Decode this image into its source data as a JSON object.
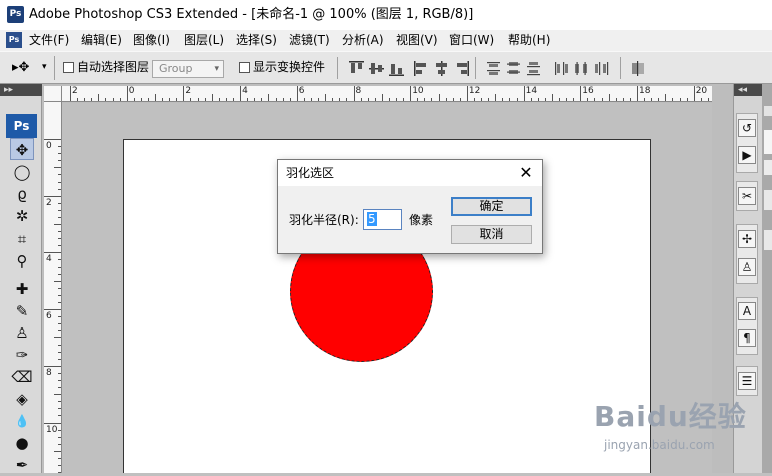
{
  "window": {
    "title": "Adobe Photoshop CS3 Extended - [未命名-1 @ 100% (图层 1, RGB/8)]",
    "app_icon": "Ps",
    "accent": "#1e5aa8"
  },
  "menu": {
    "icon": "Ps",
    "items": [
      "文件(F)",
      "编辑(E)",
      "图像(I)",
      "图层(L)",
      "选择(S)",
      "滤镜(T)",
      "分析(A)",
      "视图(V)",
      "窗口(W)",
      "帮助(H)"
    ]
  },
  "options": {
    "tool_glyph": "▸✥",
    "auto_select_label": "自动选择图层",
    "group_value": "Group",
    "show_transform_label": "显示变换控件"
  },
  "toolbox": {
    "logo": "Ps",
    "tools": [
      {
        "name": "move-tool-icon",
        "glyph": "✥"
      },
      {
        "name": "marquee-tool-icon",
        "glyph": "◯"
      },
      {
        "name": "lasso-tool-icon",
        "glyph": "ϱ"
      },
      {
        "name": "magic-wand-tool-icon",
        "glyph": "✲"
      },
      {
        "name": "crop-tool-icon",
        "glyph": "⌗"
      },
      {
        "name": "eyedropper-tool-icon",
        "glyph": "⚲"
      },
      {
        "name": "healing-brush-tool-icon",
        "glyph": "✚"
      },
      {
        "name": "brush-tool-icon",
        "glyph": "✎"
      },
      {
        "name": "stamp-tool-icon",
        "glyph": "♙"
      },
      {
        "name": "history-brush-tool-icon",
        "glyph": "✑"
      },
      {
        "name": "eraser-tool-icon",
        "glyph": "⌫"
      },
      {
        "name": "paint-bucket-tool-icon",
        "glyph": "◈"
      },
      {
        "name": "blur-tool-icon",
        "glyph": "💧"
      },
      {
        "name": "dodge-tool-icon",
        "glyph": "●"
      },
      {
        "name": "pen-tool-icon",
        "glyph": "✒"
      }
    ]
  },
  "rulers": {
    "h_labels": [
      "2",
      "0",
      "2",
      "4",
      "6",
      "8",
      "10",
      "12",
      "14",
      "16",
      "18",
      "20"
    ],
    "v_labels": [
      "0",
      "2",
      "4",
      "6",
      "8",
      "10"
    ]
  },
  "dock": {
    "buttons": [
      {
        "name": "history-panel-icon",
        "glyph": "↺"
      },
      {
        "name": "actions-panel-icon",
        "glyph": "▶"
      },
      {
        "name": "tool-presets-icon",
        "glyph": "✂"
      },
      {
        "name": "brushes-panel-icon",
        "glyph": "✢"
      },
      {
        "name": "clone-source-icon",
        "glyph": "♙"
      },
      {
        "name": "character-panel-icon",
        "glyph": "A"
      },
      {
        "name": "paragraph-panel-icon",
        "glyph": "¶"
      },
      {
        "name": "layer-comps-icon",
        "glyph": "☰"
      }
    ]
  },
  "dialog": {
    "title": "羽化选区",
    "close_glyph": "✕",
    "radius_label": "羽化半径(R):",
    "radius_value": "5",
    "unit": "像素",
    "ok_label": "确定",
    "cancel_label": "取消"
  },
  "selection": {
    "fill_color": "#ff0000"
  },
  "watermark": {
    "text": "Baidu经验",
    "sub": "jingyan.baidu.com"
  }
}
